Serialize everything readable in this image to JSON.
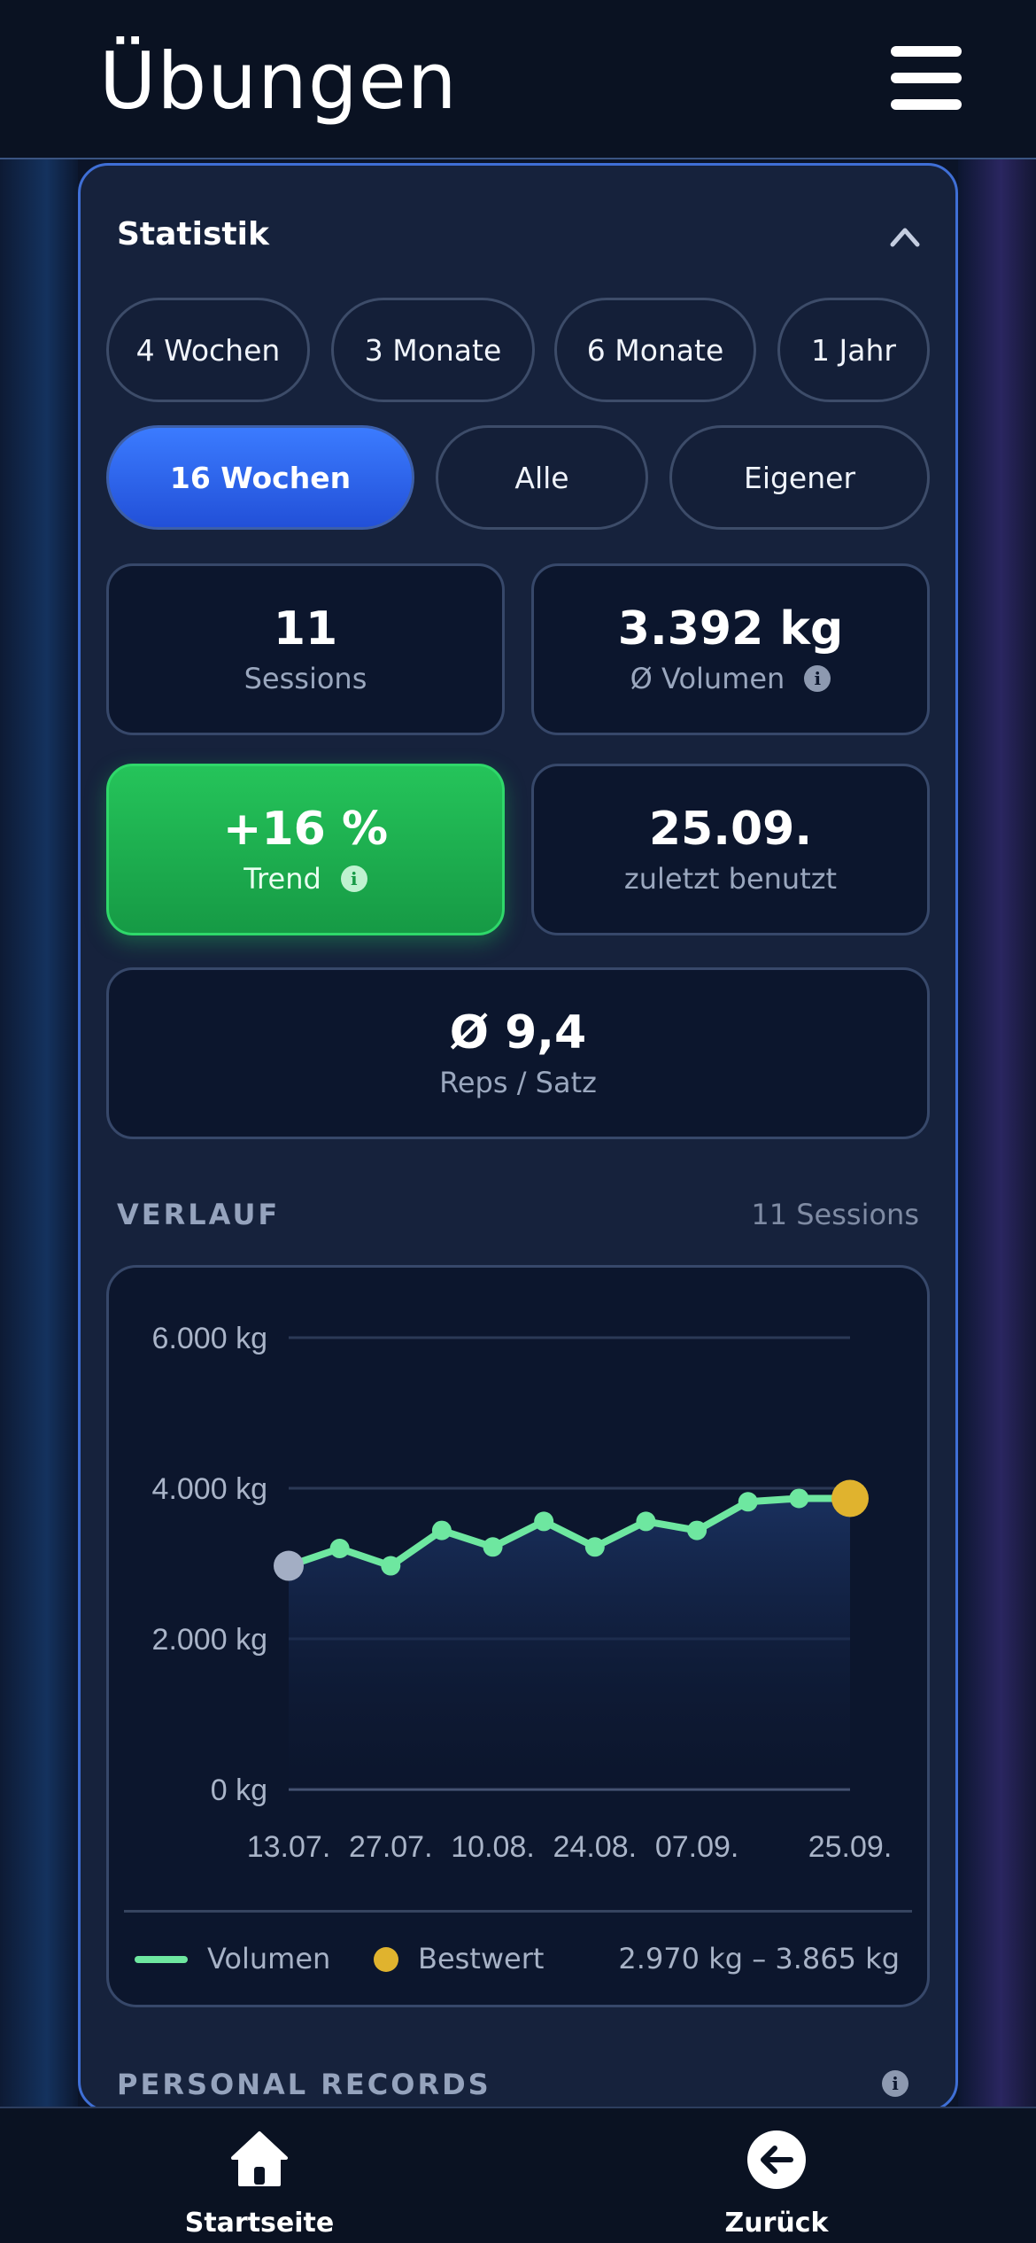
{
  "header": {
    "title": "Übungen",
    "menu_icon": "hamburger-menu-icon"
  },
  "statistik": {
    "title": "Statistik",
    "ranges": [
      {
        "label": "4 Wochen",
        "active": false
      },
      {
        "label": "3 Monate",
        "active": false
      },
      {
        "label": "6 Monate",
        "active": false
      },
      {
        "label": "1 Jahr",
        "active": false
      },
      {
        "label": "16 Wochen",
        "active": true
      },
      {
        "label": "Alle",
        "active": false
      },
      {
        "label": "Eigener",
        "active": false
      }
    ],
    "cards": {
      "sessions": {
        "value": "11",
        "label": "Sessions"
      },
      "volume": {
        "value": "3.392 kg",
        "label": "Ø Volumen"
      },
      "trend": {
        "value": "+16 %",
        "label": "Trend"
      },
      "last_used": {
        "value": "25.09.",
        "label": "zuletzt benutzt"
      },
      "reps": {
        "value": "Ø 9,4",
        "label": "Reps / Satz"
      }
    }
  },
  "verlauf": {
    "label": "VERLAUF",
    "meta": "11 Sessions",
    "legend": {
      "volume": "Volumen",
      "best": "Bestwert",
      "range": "2.970 kg – 3.865 kg"
    }
  },
  "personal_records": {
    "label": "PERSONAL RECORDS"
  },
  "nav": {
    "home": "Startseite",
    "back": "Zurück"
  },
  "colors": {
    "accent": "#3b7bff",
    "trend_green": "#22c55e",
    "line": "#6ee7a0",
    "best": "#e0b32e",
    "start_point": "#a3aec4"
  },
  "chart_data": {
    "type": "line",
    "x": [
      "13.07.",
      "20.07.",
      "27.07.",
      "03.08.",
      "10.08.",
      "17.08.",
      "24.08.",
      "31.08.",
      "07.09.",
      "14.09.",
      "21.09.",
      "25.09."
    ],
    "series": [
      {
        "name": "Volumen",
        "values": [
          2970,
          3200,
          2970,
          3440,
          3220,
          3560,
          3220,
          3560,
          3440,
          3820,
          3865,
          3865
        ]
      }
    ],
    "best": {
      "x": "25.09.",
      "value": 3865
    },
    "y_ticks": [
      "6.000 kg",
      "4.000 kg",
      "2.000 kg",
      "0 kg"
    ],
    "x_ticks": [
      "13.07.",
      "27.07.",
      "10.08.",
      "24.08.",
      "07.09.",
      "25.09."
    ],
    "ylim": [
      0,
      6000
    ],
    "grid": true
  }
}
